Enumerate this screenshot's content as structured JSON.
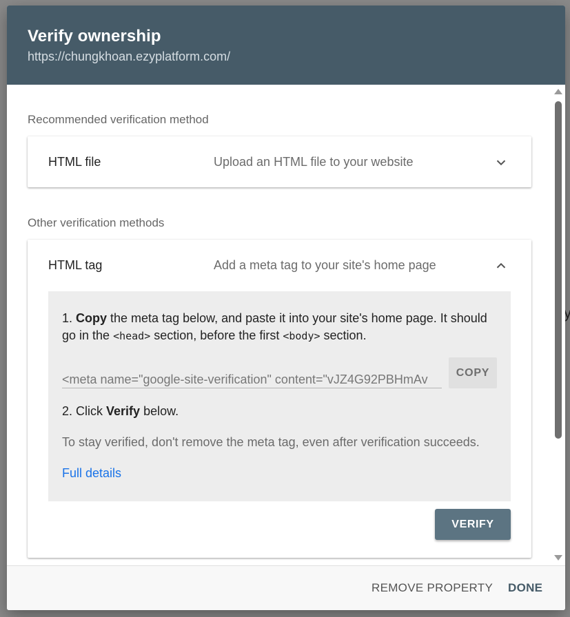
{
  "dialog": {
    "title": "Verify ownership",
    "url": "https://chungkhoan.ezyplatform.com/"
  },
  "recommended": {
    "label": "Recommended verification method",
    "method": {
      "title": "HTML file",
      "description": "Upload an HTML file to your website",
      "icon": "chevron-down-icon"
    }
  },
  "other": {
    "label": "Other verification methods",
    "method": {
      "title": "HTML tag",
      "description": "Add a meta tag to your site's home page",
      "icon": "chevron-up-icon",
      "step1": {
        "prefix": "1. ",
        "bold": "Copy",
        "text_a": " the meta tag below, and paste it into your site's home page. It should go in the ",
        "code_head": "<head>",
        "text_b": " section, before the first ",
        "code_body": "<body>",
        "text_c": " section."
      },
      "meta_tag_value": "<meta name=\"google-site-verification\" content=\"vJZ4G92PBHmAv",
      "copy_label": "COPY",
      "step2": {
        "prefix": "2. Click ",
        "bold": "Verify",
        "suffix": " below."
      },
      "note": "To stay verified, don't remove the meta tag, even after verification succeeds.",
      "link": "Full details",
      "verify_label": "VERIFY"
    }
  },
  "footer": {
    "remove_label": "REMOVE PROPERTY",
    "done_label": "DONE"
  },
  "colors": {
    "header_bg": "#465b68",
    "accent_link": "#1a73e8",
    "verify_button": "#5c7482"
  }
}
